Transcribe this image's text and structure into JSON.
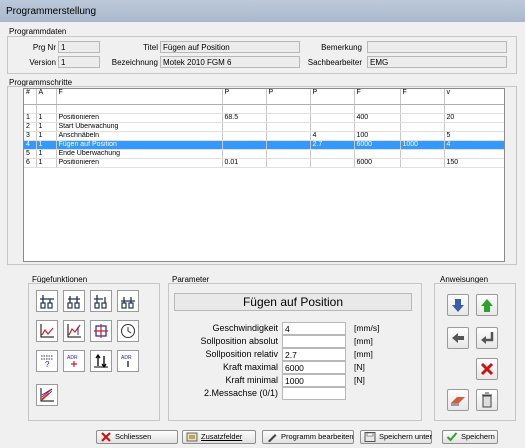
{
  "window": {
    "title": "Programmerstellung"
  },
  "programmdaten": {
    "group_title": "Programmdaten",
    "prg_nr_label": "Prg Nr",
    "prg_nr": "1",
    "titel_label": "Titel",
    "titel": "Fügen auf Position",
    "bemerkung_label": "Bemerkung",
    "bemerkung": "",
    "version_label": "Version",
    "version": "1",
    "bezeichnung_label": "Bezeichnung",
    "bezeichnung": "Motek 2010 FGM 6",
    "sachbearbeiter_label": "Sachbearbeiter",
    "sachbearbeiter": "EMG"
  },
  "programmschritte": {
    "group_title": "Programmschritte",
    "columns": [
      "#",
      "A",
      "F",
      "P",
      "P",
      "P",
      "F",
      "F",
      "v"
    ],
    "rows": [
      [
        "1",
        "1",
        "Positionieren",
        "68.5",
        "",
        "",
        "400",
        "",
        "20"
      ],
      [
        "2",
        "1",
        "Start Überwachung",
        "",
        "",
        "",
        "",
        "",
        ""
      ],
      [
        "3",
        "1",
        "Anschnäbeln",
        "",
        "",
        "4",
        "100",
        "",
        "5"
      ],
      [
        "4",
        "1",
        "Fügen auf Position",
        "",
        "",
        "2.7",
        "6000",
        "1000",
        "4"
      ],
      [
        "5",
        "1",
        "Ende Überwachung",
        "",
        "",
        "",
        "",
        "",
        ""
      ],
      [
        "6",
        "1",
        "Positionieren",
        "0.01",
        "",
        "",
        "6000",
        "",
        "150"
      ]
    ],
    "selected_row": 3
  },
  "fuegefunktionen": {
    "group_title": "Fügefunktionen",
    "icons": [
      "pos-absolute-icon",
      "pos-relative-icon",
      "pos-offset-icon",
      "pos-force-icon",
      "curve-icon",
      "curve-window-icon",
      "window-icon",
      "timer-icon",
      "keypad-icon",
      "adr-input-icon",
      "direction-icon",
      "adr-output-icon",
      "chart-icon"
    ],
    "keypad_text": "?",
    "adr_text": "ADR"
  },
  "parameter": {
    "group_title": "Parameter",
    "heading": "Fügen auf Position",
    "rows": [
      {
        "label": "Geschwindigkeit",
        "value": "4",
        "unit": "[mm/s]"
      },
      {
        "label": "Sollposition absolut",
        "value": "",
        "unit": "[mm]"
      },
      {
        "label": "Sollposition relativ",
        "value": "2.7",
        "unit": "[mm]"
      },
      {
        "label": "Kraft maximal",
        "value": "6000",
        "unit": "[N]"
      },
      {
        "label": "Kraft minimal",
        "value": "1000",
        "unit": "[N]"
      },
      {
        "label": "2.Messachse (0/1)",
        "value": "",
        "unit": ""
      }
    ]
  },
  "anweisungen": {
    "group_title": "Anweisungen"
  },
  "buttons": {
    "schliessen": "Schliessen",
    "zusatzfelder": "Zusatzfelder",
    "programm_bearbeiten": "Programm bearbeiten",
    "speichern_unter": "Speichern unter",
    "speichern": "Speichern"
  },
  "colors": {
    "selection": "#3399ff",
    "titlebar": "#b2c1d5",
    "arrow_green": "#2ea02e",
    "arrow_blue": "#3a5fa8",
    "delete_red": "#cc1111"
  }
}
